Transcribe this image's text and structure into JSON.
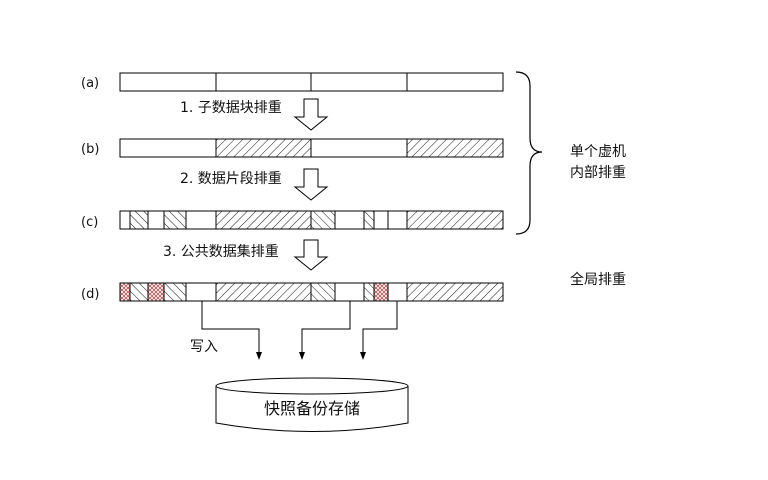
{
  "rows": {
    "a": {
      "label": "(a)"
    },
    "b": {
      "label": "(b)"
    },
    "c": {
      "label": "(c)"
    },
    "d": {
      "label": "(d)"
    }
  },
  "steps": [
    {
      "text": "1.  子数据块排重"
    },
    {
      "text": "2.  数据片段排重"
    },
    {
      "text": "3.  公共数据集排重"
    }
  ],
  "brace": {
    "line1": "单个虚机",
    "line2": "内部排重"
  },
  "global_dedup": "全局排重",
  "write_label": "写入",
  "storage_label": "快照备份存储",
  "colors": {
    "stroke": "#000000",
    "hatch": "#000000",
    "shared_chunk": "#c0504d"
  }
}
